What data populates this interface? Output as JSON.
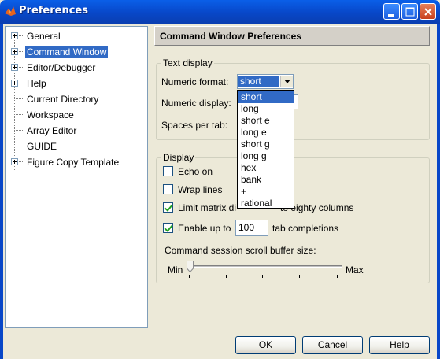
{
  "window": {
    "title": "Preferences",
    "controls": [
      "minimize-icon",
      "maximize-icon",
      "close-icon"
    ]
  },
  "tree": {
    "items": [
      {
        "label": "General",
        "expandable": true,
        "selected": false
      },
      {
        "label": "Command Window",
        "expandable": true,
        "selected": true
      },
      {
        "label": "Editor/Debugger",
        "expandable": true,
        "selected": false
      },
      {
        "label": "Help",
        "expandable": true,
        "selected": false
      },
      {
        "label": "Current Directory",
        "expandable": false,
        "selected": false
      },
      {
        "label": "Workspace",
        "expandable": false,
        "selected": false
      },
      {
        "label": "Array Editor",
        "expandable": false,
        "selected": false
      },
      {
        "label": "GUIDE",
        "expandable": false,
        "selected": false
      },
      {
        "label": "Figure Copy Template",
        "expandable": true,
        "selected": false
      }
    ]
  },
  "header": {
    "title": "Command Window Preferences"
  },
  "text_display": {
    "title": "Text display",
    "numeric_format_label": "Numeric format:",
    "numeric_format_value": "short",
    "numeric_display_label": "Numeric display:",
    "spaces_per_tab_label": "Spaces per tab:",
    "dropdown_options": [
      "short",
      "long",
      "short e",
      "long e",
      "short g",
      "long g",
      "hex",
      "bank",
      "+",
      "rational"
    ],
    "dropdown_selected": "short"
  },
  "display": {
    "title": "Display",
    "echo_on": {
      "label": "Echo on",
      "checked": false
    },
    "wrap_lines": {
      "label": "Wrap lines",
      "checked": false
    },
    "limit_matrix": {
      "label_start": "Limit matrix di",
      "label_end": "to eighty columns",
      "checked": true
    },
    "tab_completions": {
      "label_before": "Enable up to",
      "value": "100",
      "label_after": "tab completions",
      "checked": true
    },
    "scroll_buffer_label": "Command session scroll buffer size:",
    "slider": {
      "min_label": "Min",
      "max_label": "Max",
      "level": 0.0,
      "ticks": 5
    }
  },
  "buttons": {
    "ok": "OK",
    "cancel": "Cancel",
    "help": "Help"
  },
  "colors": {
    "selection": "#316AC5",
    "titlebar": "#0A5FE8",
    "dialog_bg": "#ECE9D8"
  }
}
